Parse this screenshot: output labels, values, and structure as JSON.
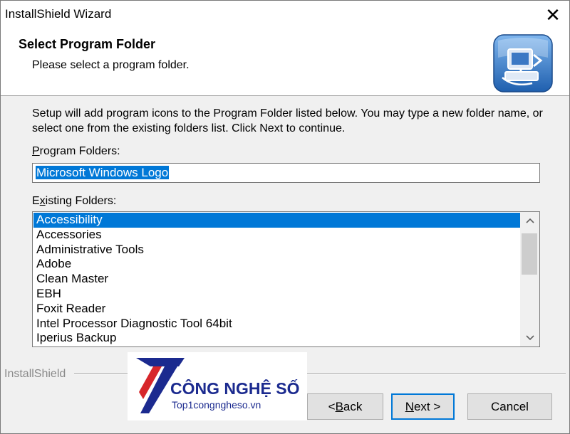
{
  "window": {
    "title": "InstallShield Wizard",
    "close_glyph": "✕"
  },
  "header": {
    "title": "Select Program Folder",
    "subtitle": "Please select a program folder.",
    "icon": "installer-computer-icon"
  },
  "body": {
    "description": "Setup will add program icons to the Program Folder listed below.  You may type a new folder name, or select one from the existing folders list.  Click Next to continue.",
    "program_folders_label_prefix": "P",
    "program_folders_label_rest": "rogram Folders:",
    "program_folder_value": "Microsoft Windows Logo",
    "existing_label_prefix": "E",
    "existing_label_accel": "x",
    "existing_label_rest": "isting Folders:",
    "existing_folders": [
      "Accessibility",
      "Accessories",
      "Administrative Tools",
      "Adobe",
      "Clean Master",
      "EBH",
      "Foxit Reader",
      "Intel Processor Diagnostic Tool 64bit",
      "Iperius Backup"
    ],
    "selected_index": 0
  },
  "footer": {
    "brand_label": "InstallShield",
    "back_prefix": "< ",
    "back_accel": "B",
    "back_rest": "ack",
    "next_accel": "N",
    "next_rest": "ext >",
    "cancel_label": "Cancel"
  },
  "watermark": {
    "brand": "CÔNG NGHỆ SỐ",
    "url": "Top1congngheso.vn"
  },
  "colors": {
    "selection": "#0078d7",
    "window_bg": "#f0f0f0",
    "watermark_blue": "#1b2a8f",
    "watermark_red": "#d7262b"
  }
}
